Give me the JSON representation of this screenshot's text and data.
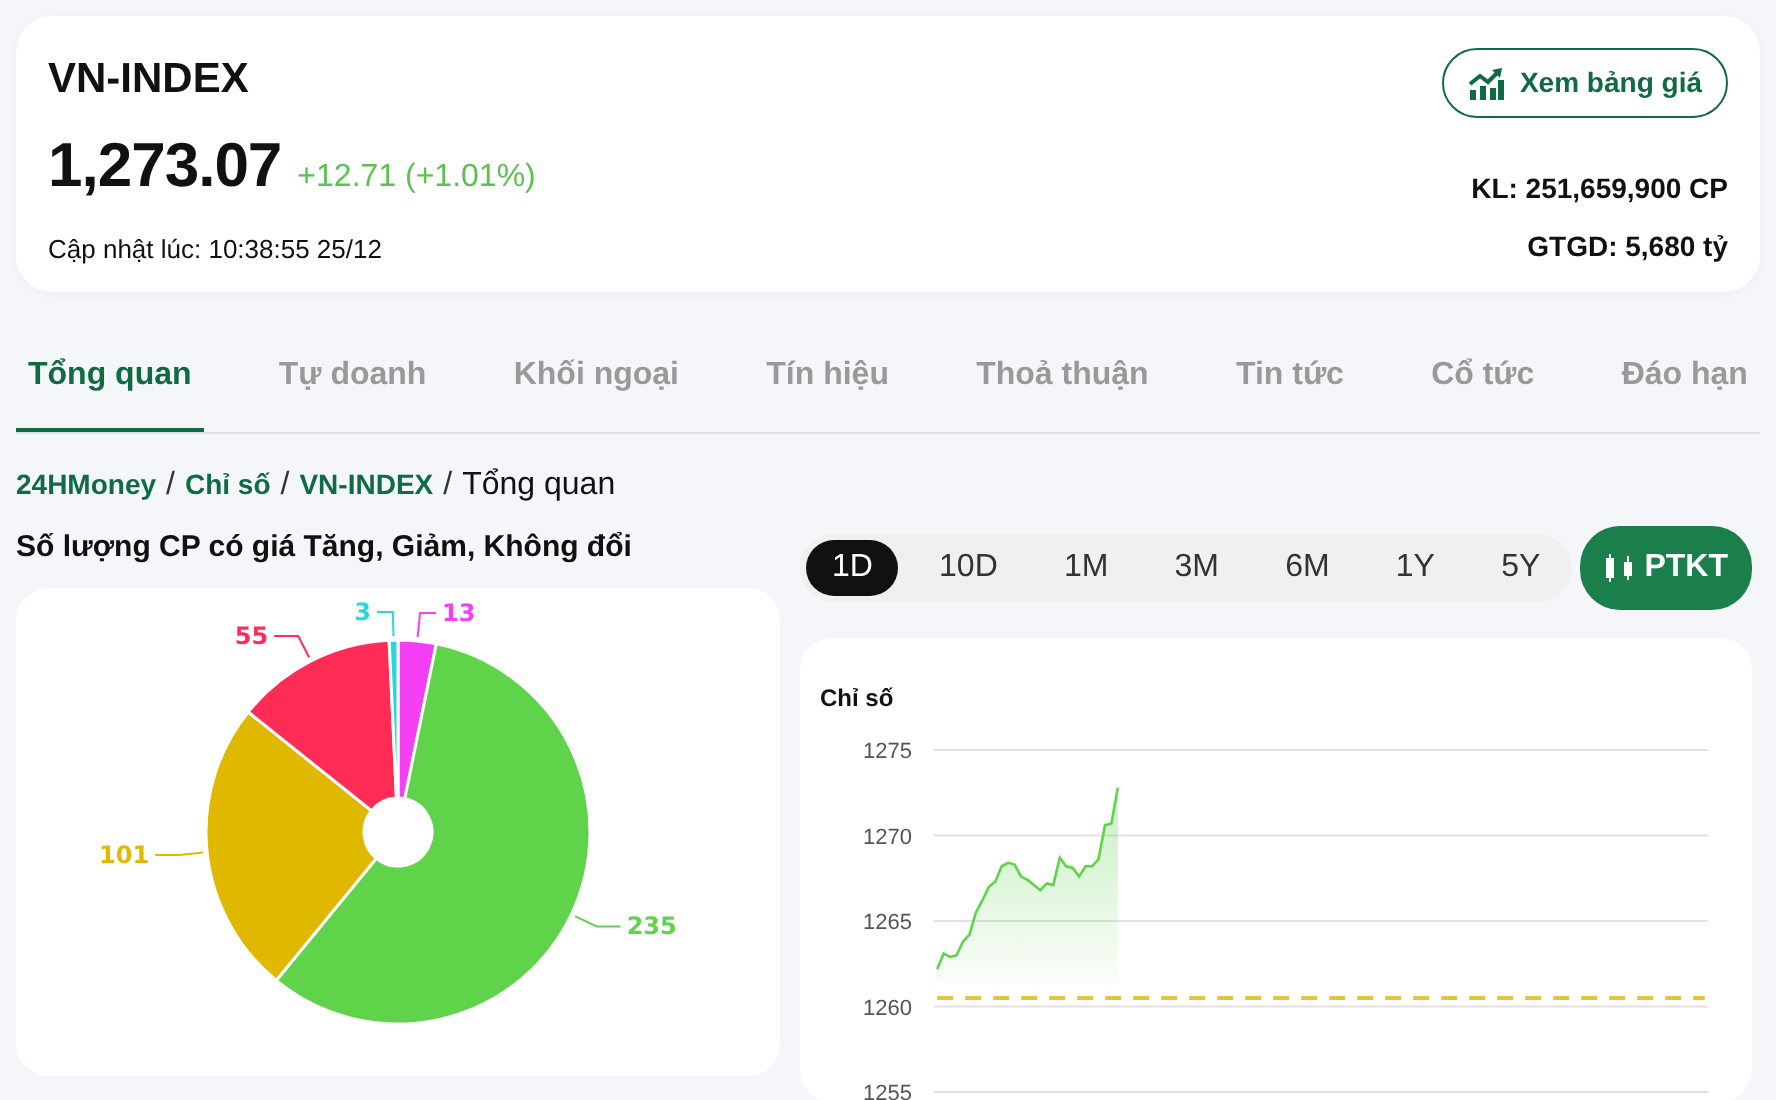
{
  "header": {
    "title": "VN-INDEX",
    "price": "1,273.07",
    "change": "+12.71 (+1.01%)",
    "updated": "Cập nhật lúc: 10:38:55 25/12",
    "button": "Xem bảng giá",
    "volume": "KL: 251,659,900 CP",
    "value": "GTGD: 5,680 tỷ"
  },
  "tabs": [
    {
      "label": "Tổng quan",
      "selected": true
    },
    {
      "label": "Tự doanh",
      "selected": false
    },
    {
      "label": "Khối ngoại",
      "selected": false
    },
    {
      "label": "Tín hiệu",
      "selected": false
    },
    {
      "label": "Thoả thuận",
      "selected": false
    },
    {
      "label": "Tin tức",
      "selected": false
    },
    {
      "label": "Cổ tức",
      "selected": false
    },
    {
      "label": "Đáo hạn",
      "selected": false
    }
  ],
  "breadcrumb": [
    {
      "label": "24HMoney",
      "link": true
    },
    {
      "separator": "/",
      "label": "Chỉ số",
      "link": true
    },
    {
      "separator": "/",
      "label": "VN-INDEX",
      "link": true
    },
    {
      "separator": "/",
      "label": "Tổng quan",
      "link": false
    }
  ],
  "pie_panel": {
    "title": "Số lượng CP có giá Tăng, Giảm, Không đổi",
    "chart_data": {
      "type": "donut",
      "data_labels": true,
      "series": [
        {
          "values": [
            13,
            235,
            101,
            55,
            3
          ],
          "colors": [
            "#f53ff5",
            "#5fd34a",
            "#e0b800",
            "#ff2d55",
            "#27d8d8"
          ]
        }
      ]
    }
  },
  "ranges": [
    {
      "label": "1D",
      "selected": true
    },
    {
      "label": "10D",
      "selected": false
    },
    {
      "label": "1M",
      "selected": false
    },
    {
      "label": "3M",
      "selected": false
    },
    {
      "label": "6M",
      "selected": false
    },
    {
      "label": "1Y",
      "selected": false
    },
    {
      "label": "5Y",
      "selected": false
    }
  ],
  "ptkt_button": "PTKT",
  "line_panel": {
    "chart_data": {
      "type": "area",
      "title": "Chỉ số",
      "ylim": [
        1255,
        1275
      ],
      "yticks": [
        1255,
        1260,
        1265,
        1270,
        1275
      ],
      "categories": [
        null,
        null,
        null,
        null,
        null,
        null,
        null,
        null,
        null,
        null,
        null,
        null,
        null,
        null,
        null,
        null,
        null,
        null,
        null,
        null,
        null,
        null,
        null,
        null,
        null,
        null,
        null,
        null,
        null,
        null,
        null,
        null,
        null,
        null,
        null,
        null,
        null,
        null,
        null,
        null,
        null,
        null,
        null,
        null,
        null,
        null,
        null,
        null,
        null,
        null,
        null,
        null,
        null,
        null,
        null,
        null,
        null,
        null,
        null,
        null,
        null,
        null,
        null,
        null,
        null,
        null,
        null,
        null,
        null,
        null,
        null,
        null,
        null,
        null,
        null,
        null,
        null,
        null,
        null,
        null,
        null,
        null,
        null,
        null,
        null,
        null,
        null,
        null,
        null,
        null,
        null,
        null,
        null,
        null,
        null,
        null,
        null,
        null,
        null,
        null,
        null,
        null,
        null,
        null,
        null,
        null,
        null,
        null,
        null,
        null,
        null,
        null,
        null,
        null,
        null,
        null,
        null,
        null,
        null,
        null
      ],
      "series": [
        {
          "color": "#5fd34a",
          "values": [
            1262.2,
            1263.1,
            1262.9,
            1263.0,
            1263.8,
            1264.2,
            1265.5,
            1266.2,
            1267.0,
            1267.3,
            1268.2,
            1268.4,
            1268.3,
            1267.6,
            1267.4,
            1267.1,
            1266.8,
            1267.2,
            1267.1,
            1268.7,
            1268.2,
            1268.1,
            1267.6,
            1268.2,
            1268.2,
            1268.6,
            1270.6,
            1270.7,
            1272.8,
            null,
            null,
            null,
            null,
            null,
            null,
            null,
            null,
            null,
            null,
            null,
            null,
            null,
            null,
            null,
            null,
            null,
            null,
            null,
            null,
            null,
            null,
            null,
            null,
            null,
            null,
            null,
            null,
            null,
            null,
            null,
            null,
            null,
            null,
            null,
            null,
            null,
            null,
            null,
            null,
            null,
            null,
            null,
            null,
            null,
            null,
            null,
            null,
            null,
            null,
            null,
            null,
            null,
            null,
            null,
            null,
            null,
            null,
            null,
            null,
            null,
            null,
            null,
            null,
            null,
            null,
            null,
            null,
            null,
            null,
            null,
            null,
            null,
            null,
            null,
            null,
            null,
            null,
            null,
            null,
            null,
            null,
            null,
            null,
            null,
            null,
            null,
            null,
            null,
            null,
            null
          ]
        },
        {
          "type": "line",
          "line_style": "dashed",
          "color": "#e5c33a",
          "values": [
            1260.5,
            1260.5,
            1260.5,
            1260.5,
            1260.5,
            1260.5,
            1260.5,
            1260.5,
            1260.5,
            1260.5,
            1260.5,
            1260.5,
            1260.5,
            1260.5,
            1260.5,
            1260.5,
            1260.5,
            1260.5,
            1260.5,
            1260.5,
            1260.5,
            1260.5,
            1260.5,
            1260.5,
            1260.5,
            1260.5,
            1260.5,
            1260.5,
            1260.5,
            1260.5,
            1260.5,
            1260.5,
            1260.5,
            1260.5,
            1260.5,
            1260.5,
            1260.5,
            1260.5,
            1260.5,
            1260.5,
            1260.5,
            1260.5,
            1260.5,
            1260.5,
            1260.5,
            1260.5,
            1260.5,
            1260.5,
            1260.5,
            1260.5,
            1260.5,
            1260.5,
            1260.5,
            1260.5,
            1260.5,
            1260.5,
            1260.5,
            1260.5,
            1260.5,
            1260.5,
            1260.5,
            1260.5,
            1260.5,
            1260.5,
            1260.5,
            1260.5,
            1260.5,
            1260.5,
            1260.5,
            1260.5,
            1260.5,
            1260.5,
            1260.5,
            1260.5,
            1260.5,
            1260.5,
            1260.5,
            1260.5,
            1260.5,
            1260.5,
            1260.5,
            1260.5,
            1260.5,
            1260.5,
            1260.5,
            1260.5,
            1260.5,
            1260.5,
            1260.5,
            1260.5,
            1260.5,
            1260.5,
            1260.5,
            1260.5,
            1260.5,
            1260.5,
            1260.5,
            1260.5,
            1260.5,
            1260.5,
            1260.5,
            1260.5,
            1260.5,
            1260.5,
            1260.5,
            1260.5,
            1260.5,
            1260.5,
            1260.5,
            1260.5,
            1260.5,
            1260.5,
            1260.5,
            1260.5,
            1260.5,
            1260.5,
            1260.5,
            1260.5,
            1260.5,
            1260.5
          ]
        }
      ],
      "grid": true
    }
  }
}
